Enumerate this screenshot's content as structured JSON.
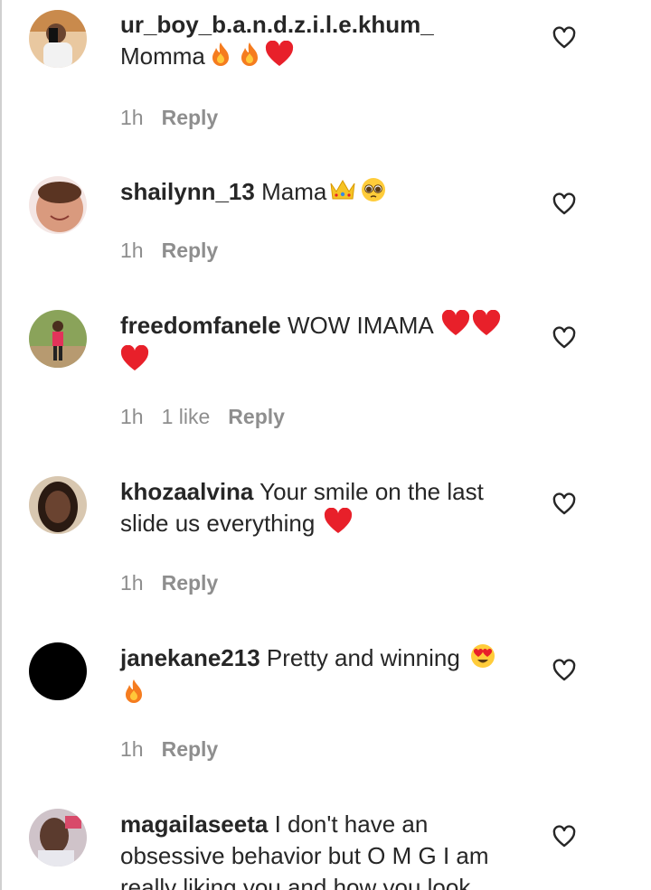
{
  "comments": [
    {
      "username": "ur_boy_b.a.n.d.z.i.l.e.khum_",
      "text_before": "",
      "text_after": "Momma",
      "emoji": [
        "fire",
        "fire",
        "red-heart"
      ],
      "text_tail": "",
      "time": "1h",
      "likes": "",
      "reply_label": "Reply"
    },
    {
      "username": "shailynn_13",
      "text_after": "Mama",
      "emoji": [
        "crown",
        "pleading-face"
      ],
      "time": "1h",
      "likes": "",
      "reply_label": "Reply"
    },
    {
      "username": "freedomfanele",
      "text_after": "WOW IMAMA",
      "emoji": [
        "red-heart",
        "red-heart",
        "red-heart"
      ],
      "time": "1h",
      "likes": "1 like",
      "reply_label": "Reply"
    },
    {
      "username": "khozaalvina",
      "text_after": "Your smile on the last slide us everything",
      "emoji": [
        "red-heart"
      ],
      "time": "1h",
      "likes": "",
      "reply_label": "Reply"
    },
    {
      "username": "janekane213",
      "text_after": "Pretty and winning",
      "emoji": [
        "heart-eyes",
        "fire"
      ],
      "time": "1h",
      "likes": "",
      "reply_label": "Reply"
    },
    {
      "username": "magailaseeta",
      "text_after": "I don't have an obsessive behavior but O M G I am really liking you and how you look",
      "emoji": [],
      "time": "",
      "likes": "",
      "reply_label": ""
    }
  ],
  "colors": {
    "username": "#262626",
    "meta": "#8e8e8e",
    "heart_red": "#e8202a",
    "fire_orange": "#f57c1f"
  },
  "icons": {
    "like_button": "heart-outline-icon"
  }
}
